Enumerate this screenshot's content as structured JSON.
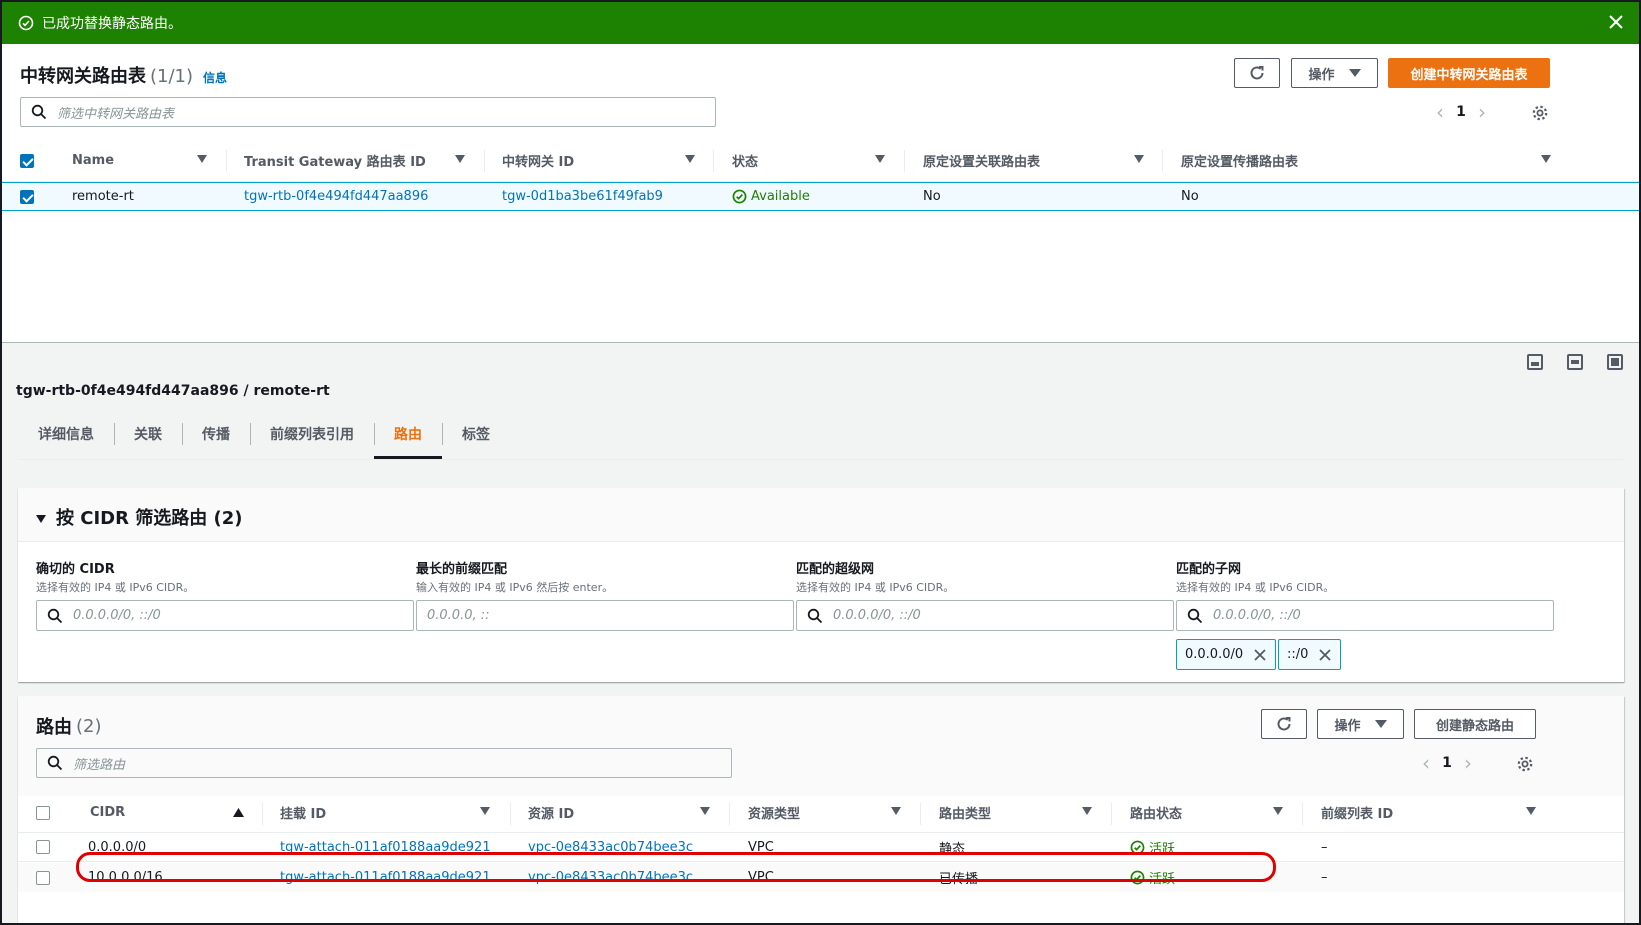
{
  "flash": {
    "message": "已成功替换静态路由。"
  },
  "top": {
    "title": "中转网关路由表",
    "count": "(1/1)",
    "info": "信息",
    "actions_label": "操作",
    "create_label": "创建中转网关路由表",
    "search_placeholder": "筛选中转网关路由表",
    "page": "1",
    "columns": [
      "Name",
      "Transit Gateway 路由表 ID",
      "中转网关 ID",
      "状态",
      "原定设置关联路由表",
      "原定设置传播路由表"
    ],
    "rows": [
      {
        "name": "remote-rt",
        "rtb_id": "tgw-rtb-0f4e494fd447aa896",
        "tgw_id": "tgw-0d1ba3be61f49fab9",
        "state": "Available",
        "assoc": "No",
        "prop": "No"
      }
    ]
  },
  "detail": {
    "breadcrumb": "tgw-rtb-0f4e494fd447aa896 / remote-rt",
    "tabs": [
      "详细信息",
      "关联",
      "传播",
      "前缀列表引用",
      "路由",
      "标签"
    ],
    "active_tab": "路由"
  },
  "filter": {
    "title": "按 CIDR 筛选路由 (2)",
    "fields": [
      {
        "label": "确切的 CIDR",
        "desc": "选择有效的 IP4 或 IPv6 CIDR。",
        "placeholder": "0.0.0.0/0, ::/0"
      },
      {
        "label": "最长的前缀匹配",
        "desc": "输入有效的 IP4 或 IPv6 然后按 enter。",
        "placeholder": "0.0.0.0, ::"
      },
      {
        "label": "匹配的超级网",
        "desc": "选择有效的 IP4 或 IPv6 CIDR。",
        "placeholder": "0.0.0.0/0, ::/0"
      },
      {
        "label": "匹配的子网",
        "desc": "选择有效的 IP4 或 IPv6 CIDR。",
        "placeholder": "0.0.0.0/0, ::/0"
      }
    ],
    "tokens": [
      "0.0.0.0/0",
      "::/0"
    ]
  },
  "routes": {
    "title": "路由",
    "count": "(2)",
    "actions_label": "操作",
    "create_label": "创建静态路由",
    "search_placeholder": "筛选路由",
    "page": "1",
    "columns": [
      "CIDR",
      "挂载 ID",
      "资源 ID",
      "资源类型",
      "路由类型",
      "路由状态",
      "前缀列表 ID"
    ],
    "rows": [
      {
        "cidr": "0.0.0.0/0",
        "attach": "tgw-attach-011af0188aa9de921",
        "resource": "vpc-0e8433ac0b74bee3c",
        "rtype": "VPC",
        "route_type": "静态",
        "state": "活跃",
        "prefix": "–"
      },
      {
        "cidr": "10.0.0.0/16",
        "attach": "tgw-attach-011af0188aa9de921",
        "resource": "vpc-0e8433ac0b74bee3c",
        "rtype": "VPC",
        "route_type": "已传播",
        "state": "活跃",
        "prefix": "–"
      }
    ]
  },
  "colors": {
    "flash": "#1d8102",
    "accent": "#ec7211",
    "link": "#0073bb",
    "highlight": "#e00000"
  }
}
